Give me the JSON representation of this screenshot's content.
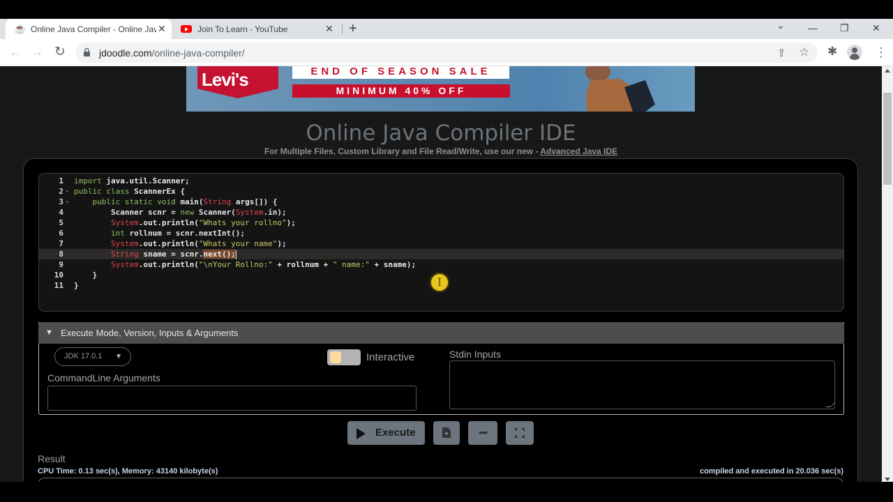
{
  "browser": {
    "tabs": [
      {
        "title": "Online Java Compiler - Online Jav",
        "icon": "jdoodle-coffee-icon",
        "active": true
      },
      {
        "title": "Join To Learn - YouTube",
        "icon": "youtube-icon",
        "active": false
      }
    ],
    "new_tab": "+",
    "url_domain": "jdoodle.com",
    "url_path": "/online-java-compiler/",
    "controls": {
      "tab_search": "⌄",
      "minimize": "—",
      "restore": "❐",
      "close": "✕"
    },
    "nav": {
      "back": "←",
      "forward": "→",
      "reload": "↻"
    },
    "toolbar_icons": {
      "share": "⇪",
      "bookmark": "☆",
      "extensions": "✱",
      "menu": "⋮"
    }
  },
  "ad": {
    "brand": "Levi's",
    "headline": "END OF SEASON SALE",
    "offer": "MINIMUM 40% OFF"
  },
  "page": {
    "title": "Online Java Compiler IDE",
    "subtitle_prefix": "For Multiple Files, Custom Library and File Read/Write, use our new - ",
    "subtitle_link": "Advanced Java IDE"
  },
  "editor": {
    "active_line": 8,
    "lines": [
      {
        "n": "1",
        "fold": "",
        "code": "<span class=\"kw\">import</span> java.util.Scanner;"
      },
      {
        "n": "2",
        "fold": "▾",
        "code": "<span class=\"kw\">public class</span> ScannerEx {"
      },
      {
        "n": "3",
        "fold": "▾",
        "code": "    <span class=\"kw\">public static void</span> main(<span class=\"ty\">String</span> args[]) {"
      },
      {
        "n": "4",
        "fold": "",
        "code": "        Scanner scnr = <span class=\"kw\">new</span> Scanner(<span class=\"ty\">System</span>.in);"
      },
      {
        "n": "5",
        "fold": "",
        "code": "        <span class=\"ty\">System</span>.out.println(<span class=\"st\">\"Whats your rollno\"</span>);"
      },
      {
        "n": "6",
        "fold": "",
        "code": "        <span class=\"kw\">int</span> rollnum = scnr.nextInt();"
      },
      {
        "n": "7",
        "fold": "",
        "code": "        <span class=\"ty\">System</span>.out.println(<span class=\"st\">\"Whats your name\"</span>);"
      },
      {
        "n": "8",
        "fold": "",
        "code": "        <span class=\"ty\">String</span> sname = scnr.<span class=\"hl\">next();</span><span class=\"caret\"></span>"
      },
      {
        "n": "9",
        "fold": "",
        "code": "        <span class=\"ty\">System</span>.out.println(<span class=\"st\">\"\\nYour Rollno:\"</span> + rollnum + <span class=\"st\">\" name:\"</span> + sname);"
      },
      {
        "n": "10",
        "fold": "",
        "code": "    }"
      },
      {
        "n": "11",
        "fold": "",
        "code": "}"
      }
    ]
  },
  "execute_panel": {
    "header": "Execute Mode, Version, Inputs & Arguments",
    "jdk_version": "JDK 17.0.1",
    "interactive_label": "Interactive",
    "interactive_on": false,
    "cla_label": "CommandLine Arguments",
    "cla_value": "",
    "stdin_label": "Stdin Inputs",
    "stdin_value": ""
  },
  "actions": {
    "execute": "Execute",
    "more": "•••"
  },
  "result": {
    "label": "Result",
    "cpu_memory": "CPU Time: 0.13 sec(s), Memory: 43140 kilobyte(s)",
    "exec_time": "compiled and executed in 20.036 sec(s)"
  }
}
